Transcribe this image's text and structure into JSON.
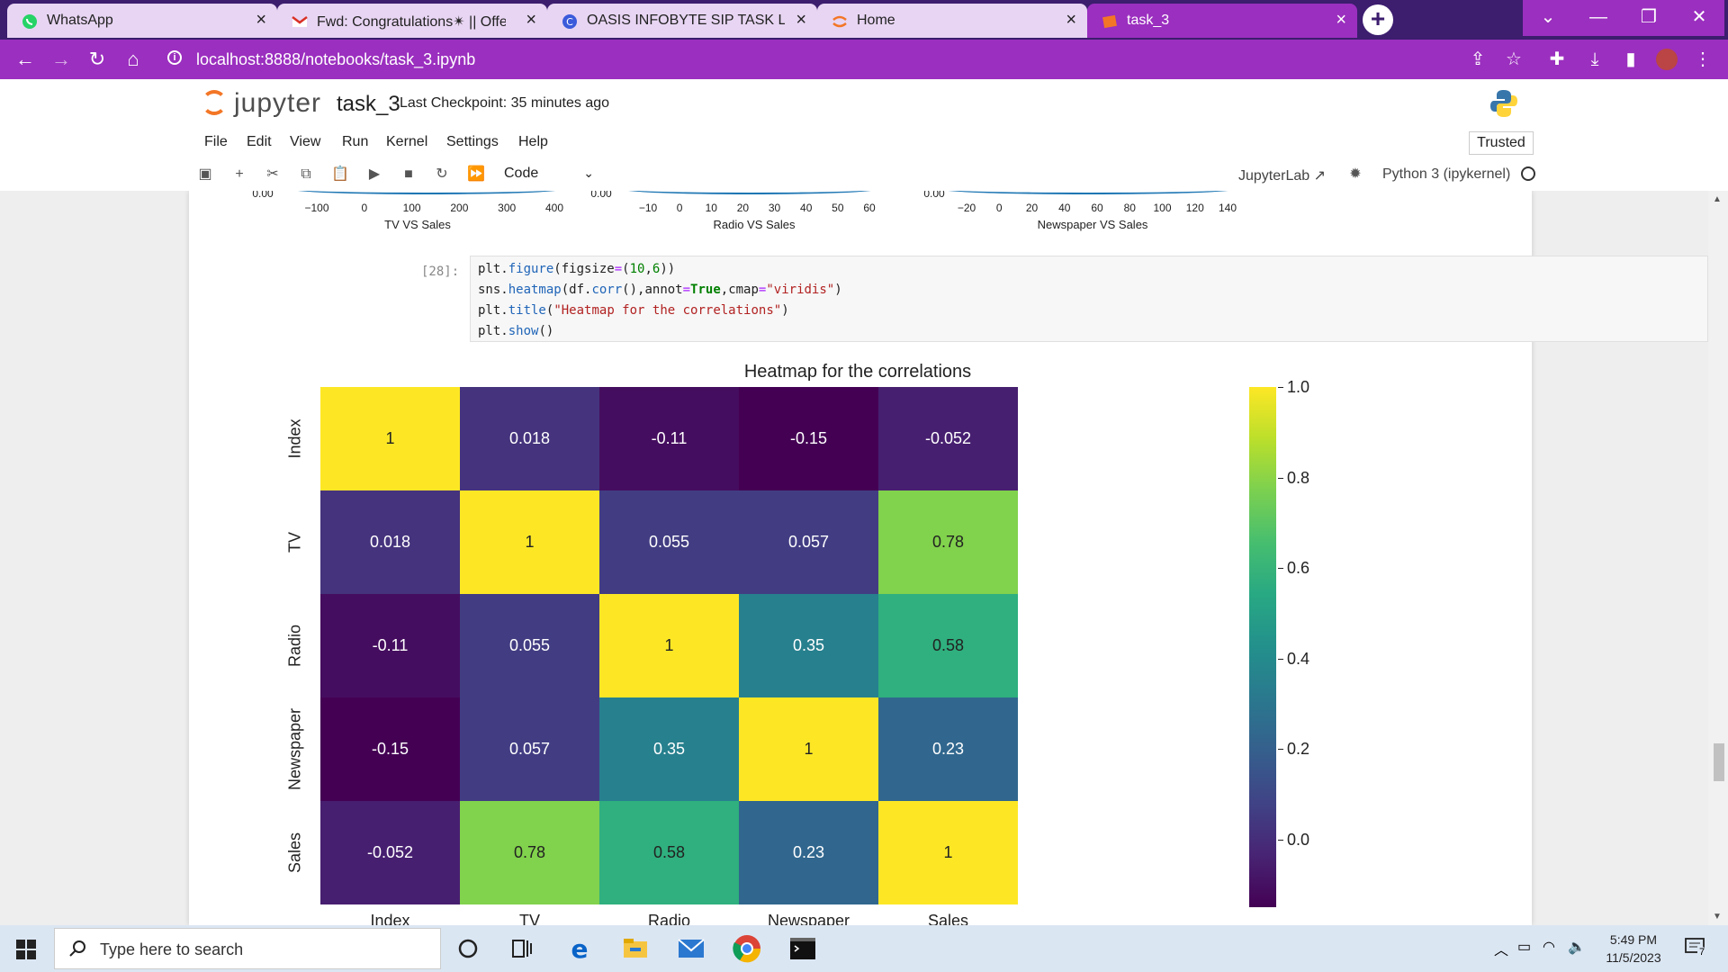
{
  "browser": {
    "tabs": [
      {
        "label": "WhatsApp",
        "icon": "whatsapp-icon",
        "active": false
      },
      {
        "label": "Fwd: Congratulations✴ || Offer",
        "icon": "gmail-icon",
        "active": false
      },
      {
        "label": "OASIS INFOBYTE SIP TASK LIST",
        "icon": "site-icon",
        "active": false
      },
      {
        "label": "Home",
        "icon": "jupyter-icon",
        "active": false
      },
      {
        "label": "task_3",
        "icon": "jupyter-icon",
        "active": true
      }
    ],
    "url": "localhost:8888/notebooks/task_3.ipynb",
    "colors": {
      "frame": "#9b2fbf",
      "tabstrip": "#3c1d6e"
    }
  },
  "jupyter": {
    "brand": "jupyter",
    "notebook_name": "task_3",
    "checkpoint": "Last Checkpoint: 35 minutes ago",
    "menu": [
      "File",
      "Edit",
      "View",
      "Run",
      "Kernel",
      "Settings",
      "Help"
    ],
    "trusted": "Trusted",
    "cell_type": "Code",
    "jupyterlab_link": "JupyterLab",
    "kernel": "Python 3 (ipykernel)"
  },
  "prev_output": {
    "plots": [
      {
        "ymin": "0.00",
        "xticks": [
          "−100",
          "0",
          "100",
          "200",
          "300",
          "400"
        ],
        "xlabel": "TV VS Sales"
      },
      {
        "ymin": "0.00",
        "xticks": [
          "−10",
          "0",
          "10",
          "20",
          "30",
          "40",
          "50",
          "60"
        ],
        "xlabel": "Radio VS Sales"
      },
      {
        "ymin": "0.00",
        "xticks": [
          "−20",
          "0",
          "20",
          "40",
          "60",
          "80",
          "100",
          "120",
          "140"
        ],
        "xlabel": "Newspaper VS Sales"
      }
    ]
  },
  "cell": {
    "prompt": "[28]:",
    "code": [
      "plt.figure(figsize=(10,6))",
      "sns.heatmap(df.corr(),annot=True,cmap=\"viridis\")",
      "plt.title(\"Heatmap for the correlations\")",
      "plt.show()"
    ]
  },
  "chart_data": {
    "type": "heatmap",
    "title": "Heatmap for the correlations",
    "labels": [
      "Index",
      "TV",
      "Radio",
      "Newspaper",
      "Sales"
    ],
    "matrix": [
      [
        1,
        0.018,
        -0.11,
        -0.15,
        -0.052
      ],
      [
        0.018,
        1,
        0.055,
        0.057,
        0.78
      ],
      [
        -0.11,
        0.055,
        1,
        0.35,
        0.58
      ],
      [
        -0.15,
        0.057,
        0.35,
        1,
        0.23
      ],
      [
        -0.052,
        0.78,
        0.58,
        0.23,
        1
      ]
    ],
    "annotations": [
      [
        "1",
        "0.018",
        "-0.11",
        "-0.15",
        "-0.052"
      ],
      [
        "0.018",
        "1",
        "0.055",
        "0.057",
        "0.78"
      ],
      [
        "-0.11",
        "0.055",
        "1",
        "0.35",
        "0.58"
      ],
      [
        "-0.15",
        "0.057",
        "0.35",
        "1",
        "0.23"
      ],
      [
        "-0.052",
        "0.78",
        "0.58",
        "0.23",
        "1"
      ]
    ],
    "colormap": "viridis",
    "vmin": -0.15,
    "vmax": 1,
    "colorbar_ticks": [
      "1.0",
      "0.8",
      "0.6",
      "0.4",
      "0.2",
      "0.0"
    ],
    "colorbar_values": [
      1.0,
      0.8,
      0.6,
      0.4,
      0.2,
      0.0
    ]
  },
  "taskbar": {
    "search_placeholder": "Type here to search",
    "time": "5:49 PM",
    "date": "11/5/2023",
    "notifications": "7"
  }
}
